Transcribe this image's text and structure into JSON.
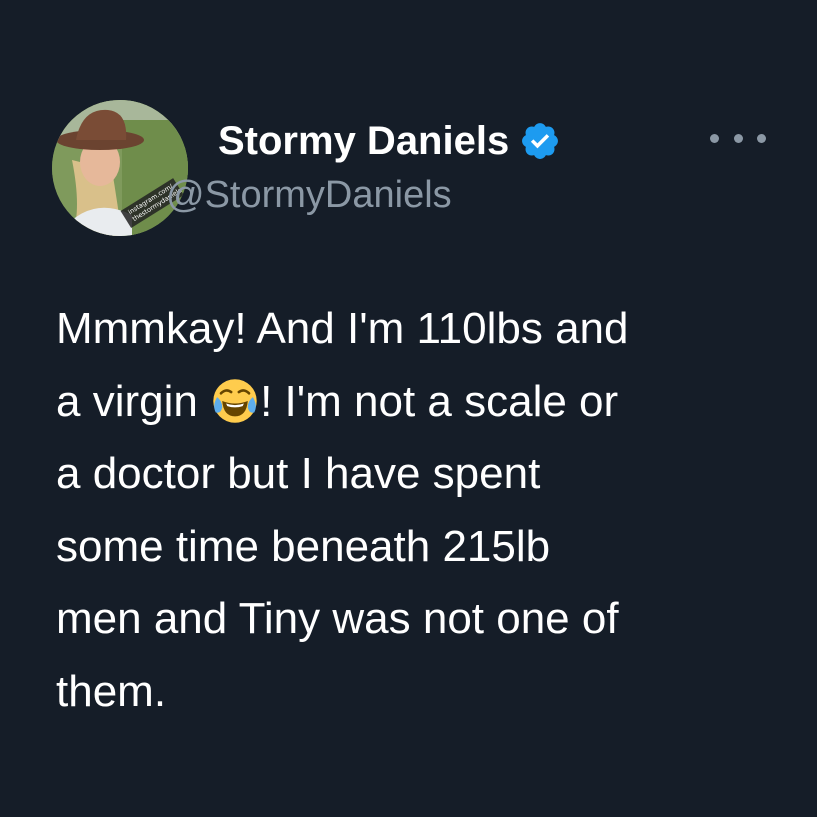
{
  "theme": {
    "background": "#151d28",
    "text": "#ffffff",
    "secondary_text": "#8b98a5",
    "verified_badge": "#1d9bf0"
  },
  "author": {
    "display_name": "Stormy Daniels",
    "handle": "@StormyDaniels",
    "verified": true,
    "avatar_watermark": "instagram.com/ thestormydaniels"
  },
  "menu": {
    "icon": "more-horizontal-icon"
  },
  "tweet": {
    "lines": [
      {
        "text": "Mmmkay! And I'm 110lbs and"
      },
      {
        "before_emoji": "a virgin ",
        "emoji": "face-with-tears-of-joy",
        "after_emoji": "! I'm not a scale or"
      },
      {
        "text": "a doctor but I have spent"
      },
      {
        "text": "some time beneath 215lb"
      },
      {
        "text": "men and Tiny was not one of"
      },
      {
        "text": "them."
      }
    ]
  }
}
